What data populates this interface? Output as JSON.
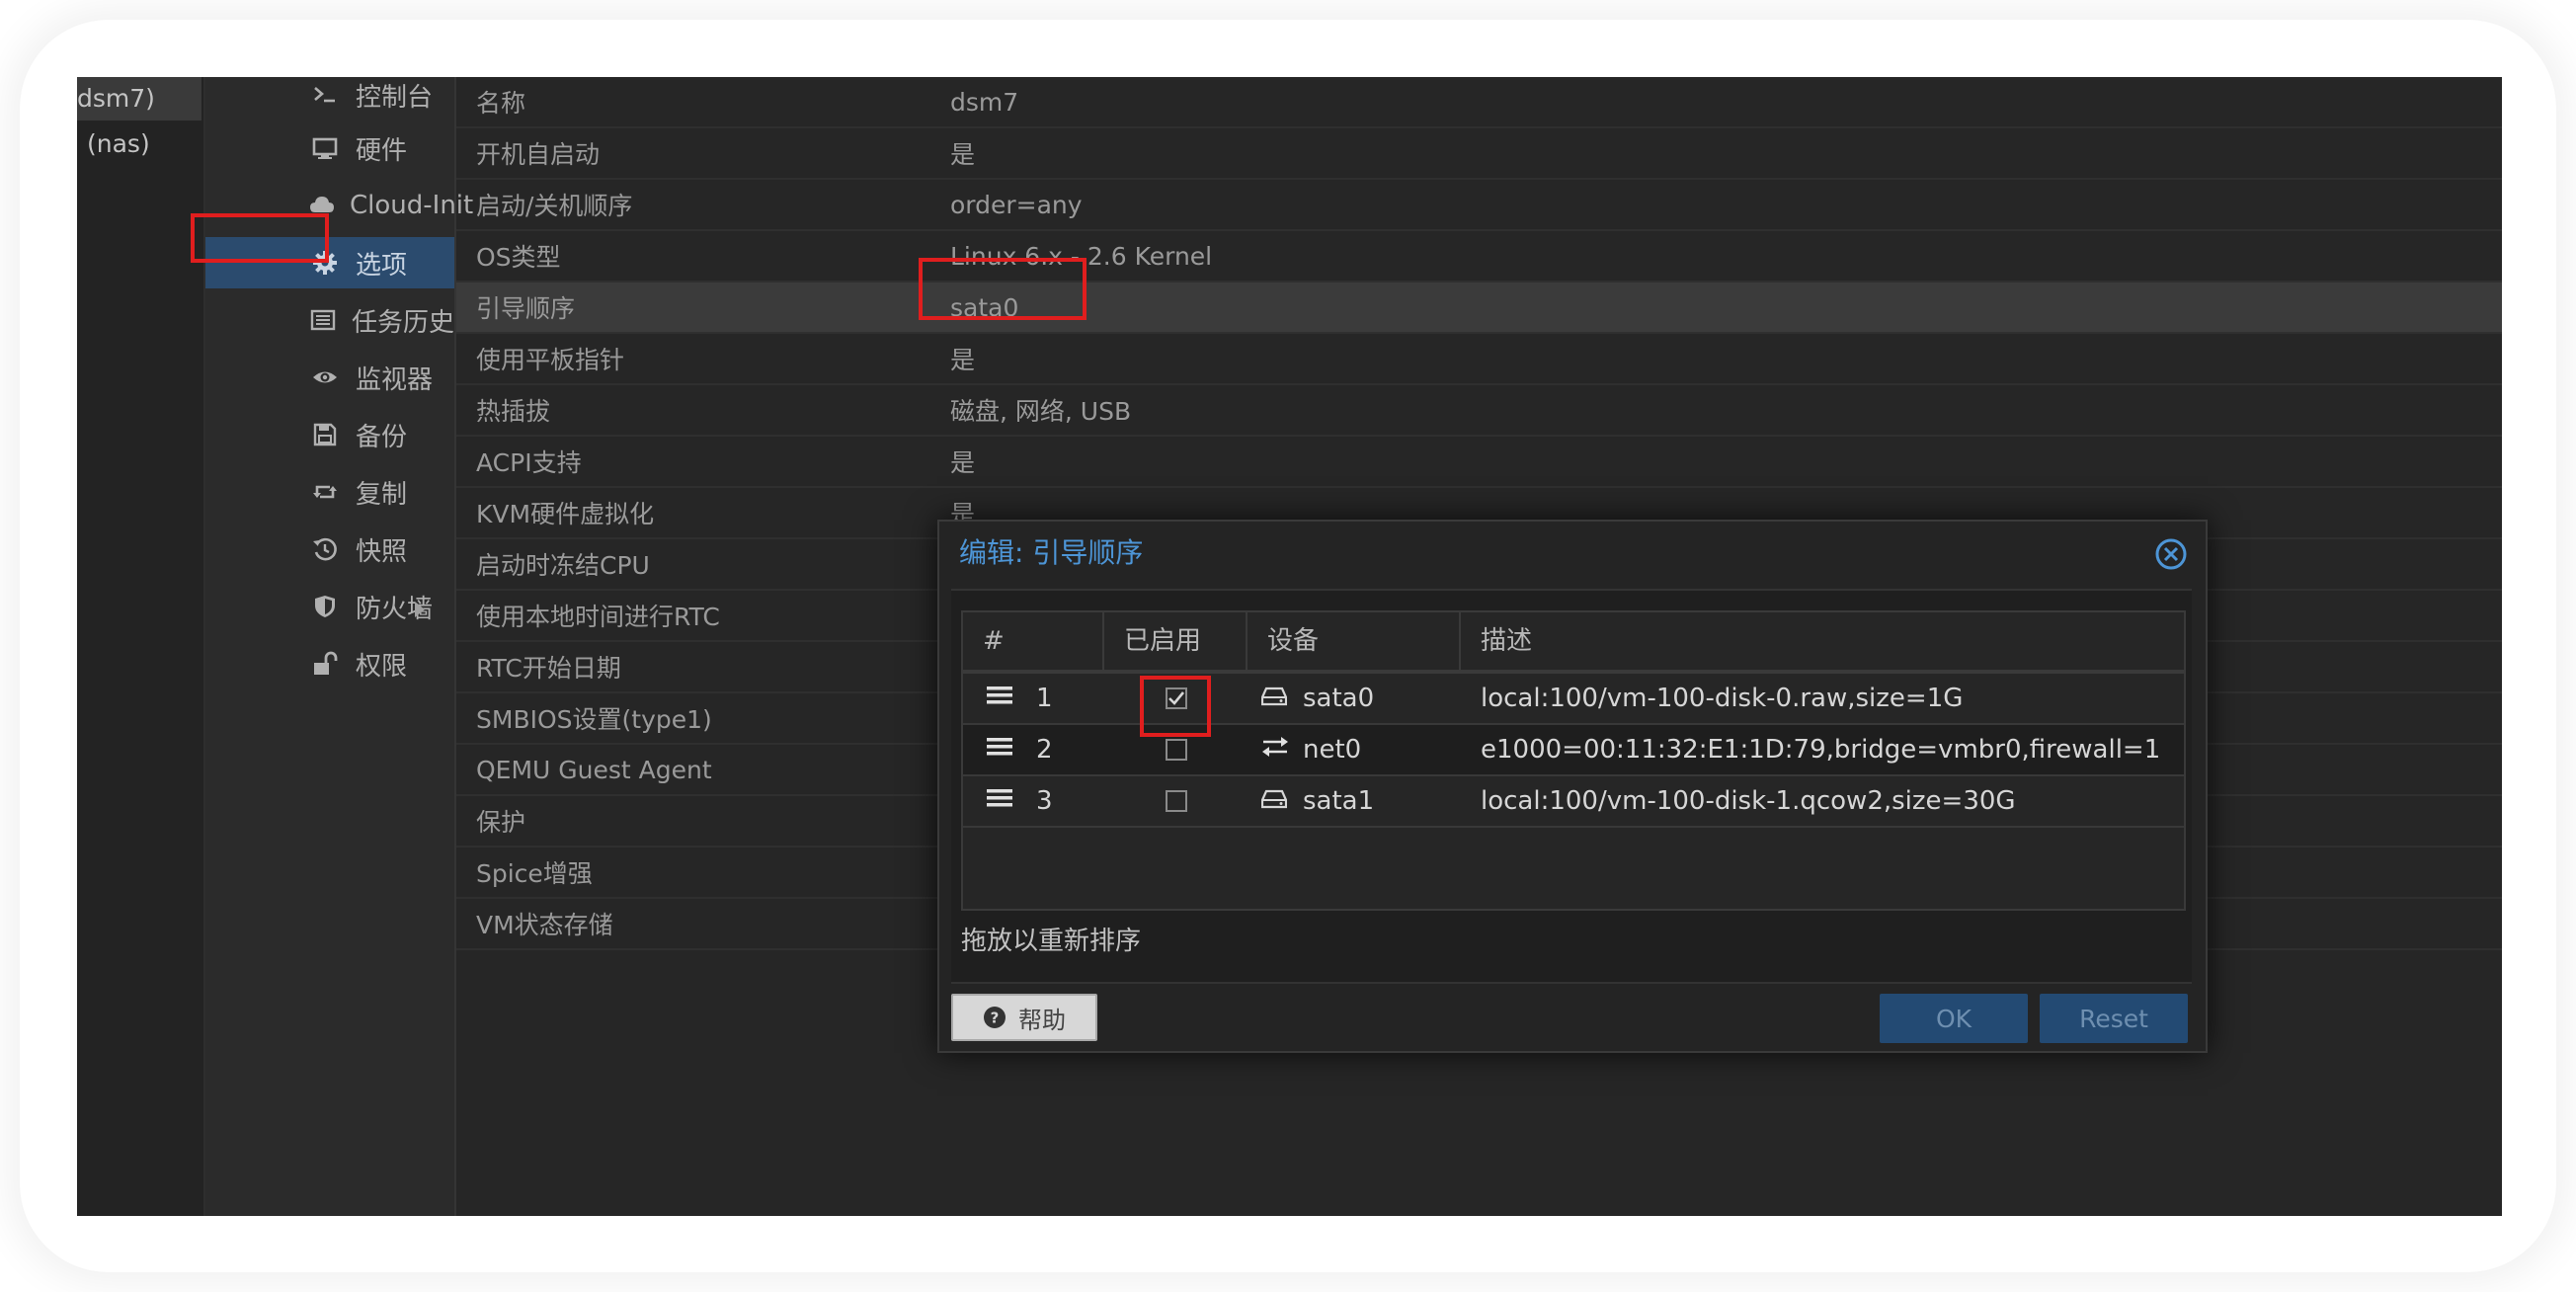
{
  "tree": {
    "items": [
      {
        "label": "dsm7)",
        "selected": true
      },
      {
        "label": "(nas)",
        "selected": false
      }
    ]
  },
  "nav": {
    "items": [
      {
        "label": "控制台",
        "icon": "terminal-icon",
        "active": false
      },
      {
        "label": "硬件",
        "icon": "monitor-icon",
        "active": false
      },
      {
        "label": "Cloud-Init",
        "icon": "cloud-icon",
        "active": false
      },
      {
        "label": "选项",
        "icon": "gear-icon",
        "active": true
      },
      {
        "label": "任务历史",
        "icon": "list-icon",
        "active": false
      },
      {
        "label": "监视器",
        "icon": "eye-icon",
        "active": false
      },
      {
        "label": "备份",
        "icon": "floppy-icon",
        "active": false
      },
      {
        "label": "复制",
        "icon": "retweet-icon",
        "active": false
      },
      {
        "label": "快照",
        "icon": "history-icon",
        "active": false
      },
      {
        "label": "防火墙",
        "icon": "shield-icon",
        "active": false,
        "has_submenu": true
      },
      {
        "label": "权限",
        "icon": "unlock-icon",
        "active": false
      }
    ]
  },
  "options": {
    "rows": [
      {
        "name": "名称",
        "value": "dsm7"
      },
      {
        "name": "开机自启动",
        "value": "是"
      },
      {
        "name": "启动/关机顺序",
        "value": "order=any"
      },
      {
        "name": "OS类型",
        "value": "Linux 6.x - 2.6 Kernel"
      },
      {
        "name": "引导顺序",
        "value": "sata0",
        "selected": true
      },
      {
        "name": "使用平板指针",
        "value": "是"
      },
      {
        "name": "热插拔",
        "value": "磁盘, 网络, USB"
      },
      {
        "name": "ACPI支持",
        "value": "是"
      },
      {
        "name": "KVM硬件虚拟化",
        "value": "是"
      },
      {
        "name": "启动时冻结CPU",
        "value": ""
      },
      {
        "name": "使用本地时间进行RTC",
        "value": ""
      },
      {
        "name": "RTC开始日期",
        "value": ""
      },
      {
        "name": "SMBIOS设置(type1)",
        "value": ""
      },
      {
        "name": "QEMU Guest Agent",
        "value": ""
      },
      {
        "name": "保护",
        "value": ""
      },
      {
        "name": "Spice增强",
        "value": ""
      },
      {
        "name": "VM状态存储",
        "value": ""
      }
    ]
  },
  "dialog": {
    "title": "编辑: 引导顺序",
    "columns": [
      "#",
      "已启用",
      "设备",
      "描述"
    ],
    "rows": [
      {
        "num": "1",
        "enabled": true,
        "device": "sata0",
        "device_icon": "hdd-icon",
        "desc": "local:100/vm-100-disk-0.raw,size=1G"
      },
      {
        "num": "2",
        "enabled": false,
        "device": "net0",
        "device_icon": "exchange-icon",
        "desc": "e1000=00:11:32:E1:1D:79,bridge=vmbr0,firewall=1"
      },
      {
        "num": "3",
        "enabled": false,
        "device": "sata1",
        "device_icon": "hdd-icon",
        "desc": "local:100/vm-100-disk-1.qcow2,size=30G"
      }
    ],
    "hint": "拖放以重新排序",
    "help_label": "帮助",
    "ok_label": "OK",
    "reset_label": "Reset"
  },
  "colors": {
    "accent": "#4d95d6",
    "active_nav": "#2b4b6e",
    "highlight": "#e01e1e",
    "button_blue": "#234a73"
  }
}
